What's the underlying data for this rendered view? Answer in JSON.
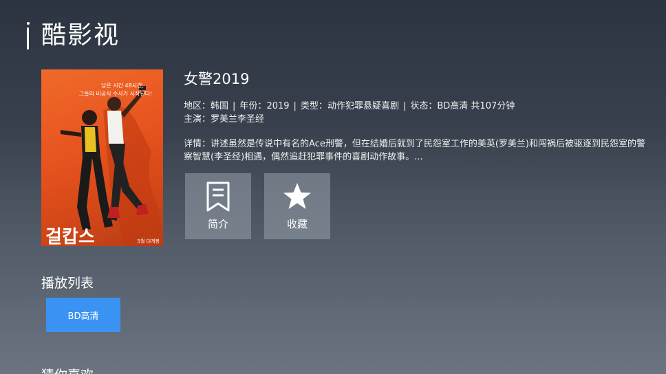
{
  "app": {
    "title": "酷影视"
  },
  "movie": {
    "title": "女警2019",
    "region_label": "地区：",
    "region": "韩国",
    "year_label": "年份：",
    "year": "2019",
    "genre_label": "类型：",
    "genre": "动作犯罪悬疑喜剧",
    "status_label": "状态：",
    "status": "BD高清 共107分钟",
    "cast_label": "主演：",
    "cast": "罗美兰李圣经",
    "desc_label": "详情：",
    "description": "讲述虽然是传说中有名的Ace刑警，但在结婚后就到了民怨室工作的美英(罗美兰)和闯祸后被驱逐到民怨室的警察智慧(李圣经)相遇，偶然追赶犯罪事件的喜剧动作故事。...",
    "poster": {
      "title_text": "걸캅스",
      "tagline_line1": "남은 시간 48시간,",
      "tagline_line2": "그들의 비공식 수사가 시작된다!",
      "release_text": "5월 대개봉"
    }
  },
  "actions": {
    "intro_label": "简介",
    "intro_icon": "bookmark-icon",
    "favorite_label": "收藏",
    "favorite_icon": "star-icon"
  },
  "playlist": {
    "title": "播放列表",
    "episodes": [
      {
        "label": "BD高清"
      }
    ]
  },
  "recommend": {
    "title": "猜你喜欢"
  },
  "colors": {
    "accent": "#3a92f2",
    "poster_orange": "#e85520"
  }
}
